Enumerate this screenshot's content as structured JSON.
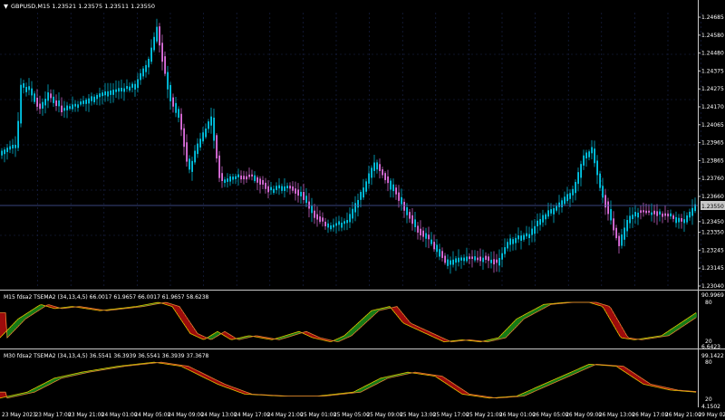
{
  "symbol_header": "GBPUSD,M15  1.23521 1.23575 1.23511 1.23550",
  "main_chart": {
    "price_ticks": [
      "1.24685",
      "1.24580",
      "1.24480",
      "1.24375",
      "1.24275",
      "1.24170",
      "1.24065",
      "1.23965",
      "1.23865",
      "1.23760",
      "1.23660",
      "1.23450",
      "1.23350",
      "1.23245",
      "1.23145",
      "1.23040"
    ],
    "current_price": "1.23550",
    "colors": {
      "bull": "#00c8e8",
      "bear": "#e070e0",
      "price_line": "#4a5aa8",
      "grid": "#1c2650",
      "frame": "#c8c8c8"
    }
  },
  "indicator_m15": {
    "label": "M15 fdsa2 TSEMA2 (34,13,4,5) 66.0017 61.9657 66.0017 61.9657 58.6238",
    "scale": [
      "90.9969",
      "80",
      "20",
      "6.6423"
    ]
  },
  "indicator_m30": {
    "label": "M30 fdsa2 TSEMA2 (34,13,4,5) 36.5541 36.3939 36.5541 36.3939 37.3678",
    "scale": [
      "99.1422",
      "80",
      "20",
      "4.1502"
    ]
  },
  "time_axis": [
    "23 May 2023",
    "23 May 17:00",
    "23 May 21:00",
    "24 May 01:00",
    "24 May 05:00",
    "24 May 09:00",
    "24 May 13:00",
    "24 May 17:00",
    "24 May 21:00",
    "25 May 01:00",
    "25 May 05:00",
    "25 May 09:00",
    "25 May 13:00",
    "25 May 17:00",
    "25 May 21:00",
    "26 May 01:00",
    "26 May 05:00",
    "26 May 09:00",
    "26 May 13:00",
    "26 May 17:00",
    "26 May 21:00",
    "29 May 02:00"
  ],
  "indicator_colors": {
    "up": "#20b020",
    "down": "#e01010",
    "line_fast": "#e0c000",
    "line_slow": "#e08030"
  }
}
